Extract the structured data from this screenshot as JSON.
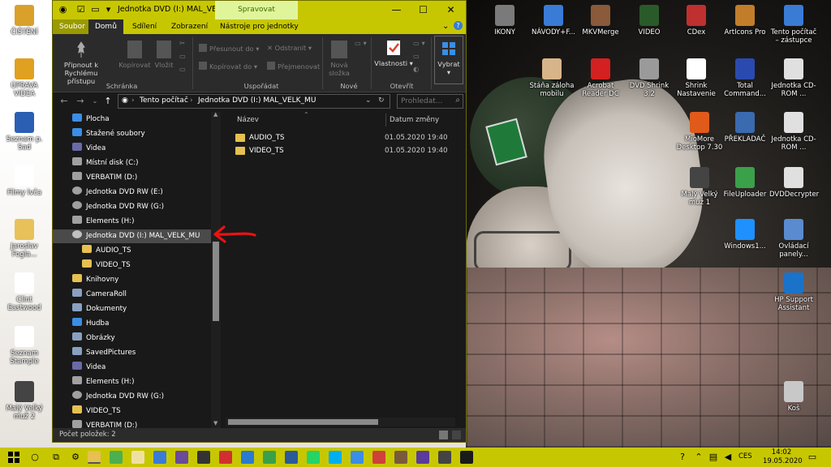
{
  "desktop": {
    "left_icons": [
      {
        "label": "ČIŠTĚNÍ",
        "icon": "cleanup-icon",
        "color": "#d9a12a"
      },
      {
        "label": "ÚPRAVA VIDEA",
        "icon": "audio-video-icon",
        "color": "#e0a020"
      },
      {
        "label": "Seznam p. Sad",
        "icon": "word-document-icon",
        "color": "#2b5fb4"
      },
      {
        "label": "Filmy lvča",
        "icon": "text-document-icon",
        "color": "#ffffff"
      },
      {
        "label": "Jaroslav Fogla...",
        "icon": "yellow-document-icon",
        "color": "#e8c15a"
      },
      {
        "label": "Clint Eastwood",
        "icon": "text-document-icon",
        "color": "#ffffff"
      },
      {
        "label": "Seznam Stample",
        "icon": "text-document-icon",
        "color": "#ffffff"
      },
      {
        "label": "Malý Velký muž 2",
        "icon": "movie-icon",
        "color": "#444444"
      }
    ],
    "right_icons": [
      {
        "label": "IKONY",
        "icon": "settings-folder-icon",
        "color": "#7a7a7a"
      },
      {
        "label": "NÁVODY+F...",
        "icon": "blue-shortcut-icon",
        "color": "#3a7bd5"
      },
      {
        "label": "MKVMerge",
        "icon": "mkvmerge-icon",
        "color": "#8a5a3a"
      },
      {
        "label": "VIDEO",
        "icon": "video-clapper-icon",
        "color": "#2a5a2a"
      },
      {
        "label": "CDex",
        "icon": "cdex-icon",
        "color": "#c03030"
      },
      {
        "label": "ArtIcons Pro",
        "icon": "articons-icon",
        "color": "#c27d2a"
      },
      {
        "label": "Tento počítač – zástupce",
        "icon": "computer-icon",
        "color": "#3a7bd5"
      },
      {
        "label": "Stáňa záloha mobilu",
        "icon": "photo-icon",
        "color": "#d8b48a"
      },
      {
        "label": "Acrobat Reader DC",
        "icon": "acrobat-icon",
        "color": "#d42020"
      },
      {
        "label": "DVD Shrink 3.2",
        "icon": "dvd-shrink-icon",
        "color": "#9a9a9a"
      },
      {
        "label": "Shrink Nastavenie",
        "icon": "text-document-icon",
        "color": "#ffffff"
      },
      {
        "label": "Total Command...",
        "icon": "total-commander-icon",
        "color": "#2a4ab0"
      },
      {
        "label": "Jednotka CD-ROM ...",
        "icon": "cdrom-icon",
        "color": "#e0e0e0"
      },
      {
        "label": "MioMore Desktop 7.30",
        "icon": "miomore-icon",
        "color": "#e05a1a"
      },
      {
        "label": "PŘEKLADAČ",
        "icon": "translator-icon",
        "color": "#3a6ab0"
      },
      {
        "label": "Jednotka CD-ROM ...",
        "icon": "cdrom-icon",
        "color": "#e0e0e0"
      },
      {
        "label": "Malý Velký muž 1",
        "icon": "movie-icon",
        "color": "#444444"
      },
      {
        "label": "FileUploader",
        "icon": "upload-icon",
        "color": "#3aa04a"
      },
      {
        "label": "DVDDecrypter",
        "icon": "dvd-decrypter-icon",
        "color": "#e0e0e0"
      },
      {
        "label": "Windows1...",
        "icon": "windows-icon",
        "color": "#1e90ff"
      },
      {
        "label": "Ovládací panely...",
        "icon": "control-panel-icon",
        "color": "#5a8ad0"
      },
      {
        "label": "HP Support Assistant",
        "icon": "hp-help-icon",
        "color": "#1a73c8"
      },
      {
        "label": "Koš",
        "icon": "recycle-bin-icon",
        "color": "#c8c8c8"
      }
    ]
  },
  "explorer": {
    "title": "Jednotka DVD (I:) MAL_VE...",
    "manage_tab": "Spravovat",
    "window_buttons": {
      "minimize": "—",
      "maximize": "☐",
      "close": "✕"
    },
    "ribbon_tabs": [
      "Soubor",
      "Domů",
      "Sdílení",
      "Zobrazení",
      "Nástroje pro jednotky"
    ],
    "ribbon": {
      "pin_label": "Připnout k Rychlému přístupu",
      "copy_label": "Kopírovat",
      "paste_label": "Vložit",
      "group_clipboard": "Schránka",
      "move_to": "Přesunout do",
      "copy_to": "Kopírovat do",
      "delete": "Odstranit",
      "rename": "Přejmenovat",
      "group_organize": "Uspořádat",
      "new_folder": "Nová složka",
      "group_new": "Nové",
      "properties": "Vlastnosti",
      "group_open": "Otevřít",
      "select": "Vybrat"
    },
    "address": {
      "root": "Tento počítač",
      "current": "Jednotka DVD (I:) MAL_VELK_MU",
      "search_placeholder": "Prohledat..."
    },
    "nav_items": [
      {
        "label": "Plocha",
        "icon": "desktop-folder-icon",
        "color": "#3a8ee6",
        "indent": 1
      },
      {
        "label": "Stažené soubory",
        "icon": "downloads-icon",
        "color": "#3a8ee6",
        "indent": 1
      },
      {
        "label": "Videa",
        "icon": "videos-folder-icon",
        "color": "#6a6aa8",
        "indent": 1
      },
      {
        "label": "Místní disk (C:)",
        "icon": "drive-icon",
        "color": "#a0a0a0",
        "indent": 1
      },
      {
        "label": "VERBATIM (D:)",
        "icon": "drive-icon",
        "color": "#a0a0a0",
        "indent": 1
      },
      {
        "label": "Jednotka DVD RW (E:)",
        "icon": "dvd-drive-icon",
        "color": "#a0a0a0",
        "indent": 1
      },
      {
        "label": "Jednotka DVD RW (G:)",
        "icon": "dvd-drive-icon",
        "color": "#a0a0a0",
        "indent": 1
      },
      {
        "label": "Elements (H:)",
        "icon": "drive-icon",
        "color": "#a0a0a0",
        "indent": 1
      },
      {
        "label": "Jednotka DVD (I:) MAL_VELK_MU",
        "icon": "dvd-disc-icon",
        "color": "#c0c0c0",
        "indent": 1,
        "selected": true
      },
      {
        "label": "AUDIO_TS",
        "icon": "folder-icon",
        "color": "#e6c050",
        "indent": 2
      },
      {
        "label": "VIDEO_TS",
        "icon": "folder-icon",
        "color": "#e6c050",
        "indent": 2
      },
      {
        "label": "Knihovny",
        "icon": "libraries-icon",
        "color": "#e6c050",
        "indent": 0
      },
      {
        "label": "CameraRoll",
        "icon": "camera-roll-icon",
        "color": "#8aa0c0",
        "indent": 1
      },
      {
        "label": "Dokumenty",
        "icon": "documents-icon",
        "color": "#8aa0c0",
        "indent": 1
      },
      {
        "label": "Hudba",
        "icon": "music-icon",
        "color": "#3a8ee6",
        "indent": 1
      },
      {
        "label": "Obrázky",
        "icon": "pictures-icon",
        "color": "#8aa0c0",
        "indent": 1
      },
      {
        "label": "SavedPictures",
        "icon": "saved-pictures-icon",
        "color": "#8aa0c0",
        "indent": 1
      },
      {
        "label": "Videa",
        "icon": "videos-folder-icon",
        "color": "#6a6aa8",
        "indent": 1
      },
      {
        "label": "Elements (H:)",
        "icon": "drive-icon",
        "color": "#a0a0a0",
        "indent": 0
      },
      {
        "label": "Jednotka DVD RW (G:)",
        "icon": "dvd-drive-icon",
        "color": "#a0a0a0",
        "indent": 0
      },
      {
        "label": "VIDEO_TS",
        "icon": "folder-icon",
        "color": "#e6c050",
        "indent": 1
      },
      {
        "label": "VERBATIM (D:)",
        "icon": "drive-icon",
        "color": "#a0a0a0",
        "indent": 0
      }
    ],
    "columns": {
      "name": "Název",
      "date": "Datum změny"
    },
    "files": [
      {
        "name": "AUDIO_TS",
        "date": "01.05.2020 19:40"
      },
      {
        "name": "VIDEO_TS",
        "date": "01.05.2020 19:40"
      }
    ],
    "status": "Počet položek: 2"
  },
  "taskbar": {
    "language": "CES",
    "time": "14:02",
    "date": "19.05.2020",
    "accent": "#c7c701"
  }
}
